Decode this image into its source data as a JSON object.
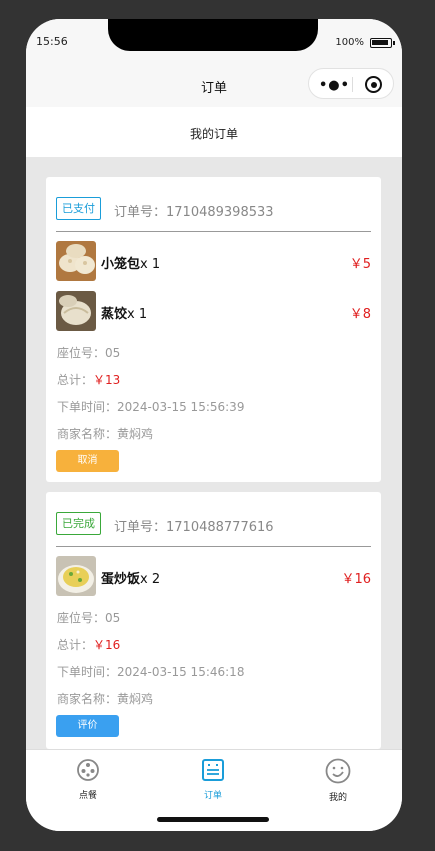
{
  "status_bar": {
    "time": "15:56",
    "battery": "100%"
  },
  "navbar": {
    "title": "订单",
    "menu_icon": "more-dots-icon",
    "close_icon": "target-close-icon"
  },
  "header": {
    "title": "我的订单"
  },
  "orders": [
    {
      "status": "已支付",
      "order_no": "订单号：1710489398533",
      "items": [
        {
          "name": "小笼包",
          "qty": "x 1",
          "price": "￥5",
          "thumb": "dumpling-photo"
        },
        {
          "name": "蒸饺",
          "qty": "x 1",
          "price": "￥8",
          "thumb": "steamed-dumpling-photo"
        }
      ],
      "seat_label": "座位号：05",
      "total_label": "总计：",
      "total_value": "￥13",
      "time_label": "下单时间：2024-03-15 15:56:39",
      "merchant_label": "商家名称：黄焖鸡",
      "action": "取消"
    },
    {
      "status": "已完成",
      "order_no": "订单号：1710488777616",
      "items": [
        {
          "name": "蛋炒饭",
          "qty": "x 2",
          "price": "￥16",
          "thumb": "fried-rice-photo"
        }
      ],
      "seat_label": "座位号：05",
      "total_label": "总计：",
      "total_value": "￥16",
      "time_label": "下单时间：2024-03-15 15:46:18",
      "merchant_label": "商家名称：黄焖鸡",
      "action": "评价"
    }
  ],
  "tabbar": {
    "tabs": [
      {
        "label": "点餐",
        "icon": "food-icon",
        "active": false
      },
      {
        "label": "订单",
        "icon": "order-icon",
        "active": true
      },
      {
        "label": "我的",
        "icon": "profile-icon",
        "active": false
      }
    ]
  },
  "colors": {
    "accent": "#1a9dd9",
    "price_red": "#e02020",
    "cancel": "#f7b13c",
    "review": "#3aa0f0",
    "done": "#3aa83a"
  }
}
